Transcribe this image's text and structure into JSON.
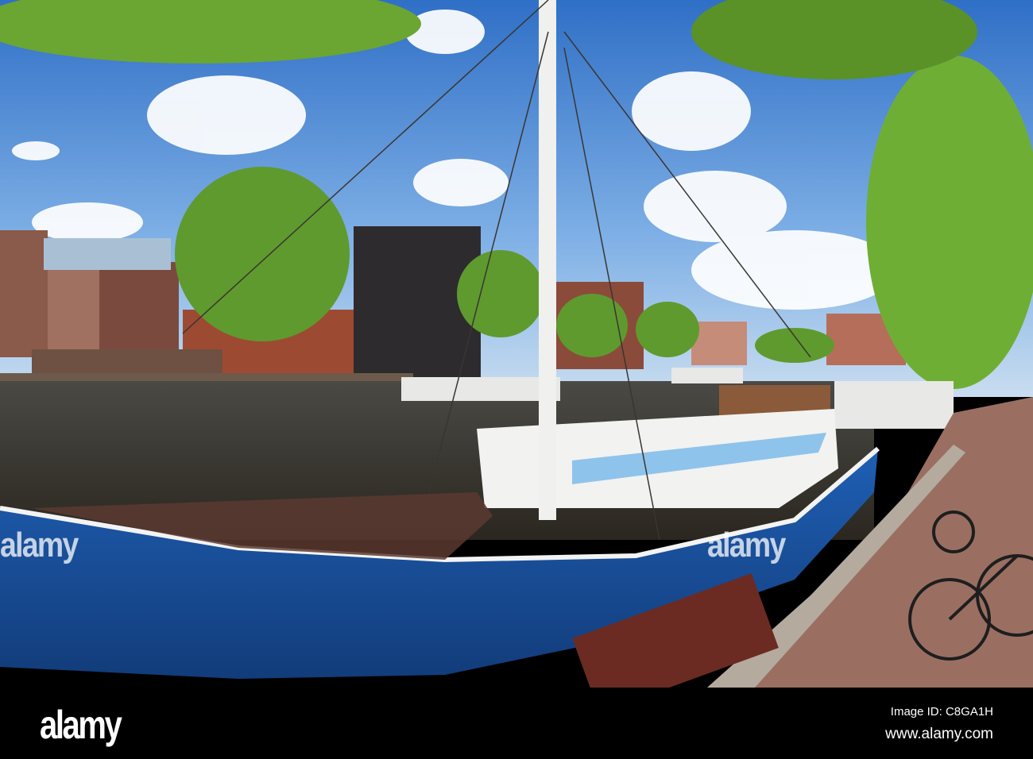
{
  "watermark": {
    "text": "alamy"
  },
  "footer": {
    "logo": "alamy",
    "image_id": "Image ID: C8GA1H",
    "url": "www.alamy.com"
  }
}
